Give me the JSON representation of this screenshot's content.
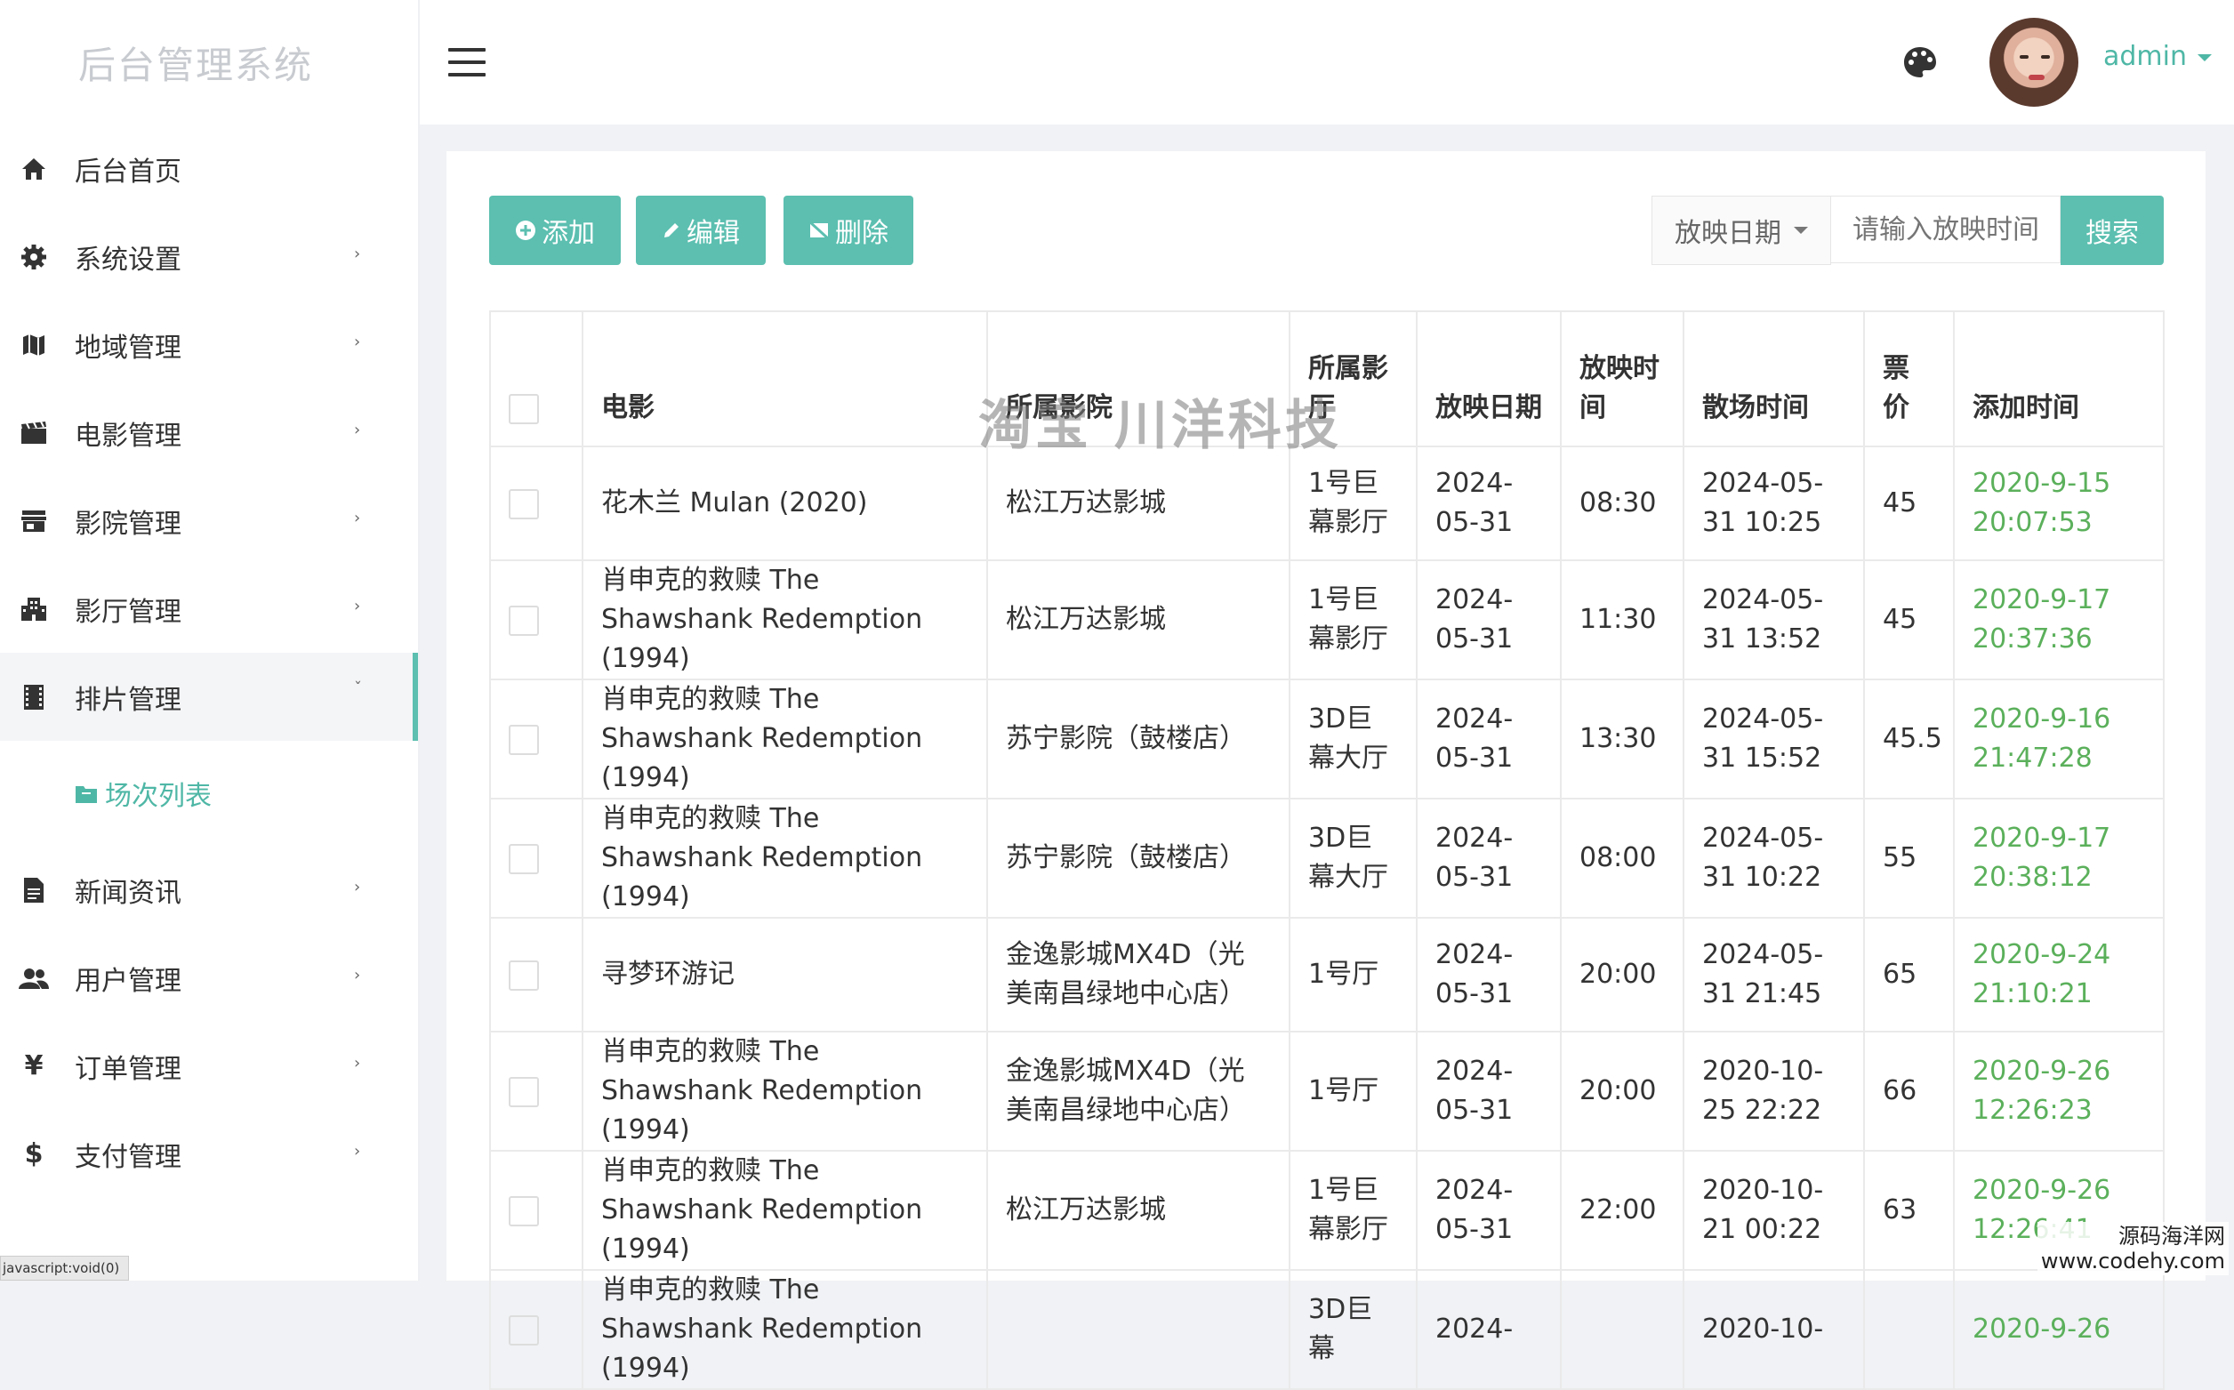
{
  "brand": "后台管理系统",
  "sidebar": {
    "items": [
      {
        "label": "后台首页",
        "icon": "home-icon",
        "has_arrow": false
      },
      {
        "label": "系统设置",
        "icon": "gear-icon",
        "has_arrow": true
      },
      {
        "label": "地域管理",
        "icon": "map-icon",
        "has_arrow": true
      },
      {
        "label": "电影管理",
        "icon": "film-icon",
        "has_arrow": true
      },
      {
        "label": "影院管理",
        "icon": "store-icon",
        "has_arrow": true
      },
      {
        "label": "影厅管理",
        "icon": "building-icon",
        "has_arrow": true
      },
      {
        "label": "排片管理",
        "icon": "schedule-icon",
        "has_arrow": true,
        "expanded": true
      },
      {
        "label": "新闻资讯",
        "icon": "news-icon",
        "has_arrow": true
      },
      {
        "label": "用户管理",
        "icon": "users-icon",
        "has_arrow": true
      },
      {
        "label": "订单管理",
        "icon": "yen-icon",
        "has_arrow": true
      },
      {
        "label": "支付管理",
        "icon": "dollar-icon",
        "has_arrow": true
      }
    ],
    "subitem": "场次列表",
    "status_tip": "javascript:void(0)"
  },
  "header": {
    "username": "admin"
  },
  "toolbar": {
    "add_label": "添加",
    "edit_label": "编辑",
    "delete_label": "删除",
    "filter_select": "放映日期",
    "search_placeholder": "请输入放映时间",
    "search_label": "搜索"
  },
  "table": {
    "headers": [
      "电影",
      "所属影院",
      "所属影厅",
      "放映日期",
      "放映时间",
      "散场时间",
      "票价",
      "添加时间"
    ],
    "rows": [
      {
        "movie": "花木兰 Mulan (2020)",
        "cinema": "松江万达影城",
        "hall": "1号巨幕影厅",
        "date": "2024-05-31",
        "time": "08:30",
        "end": "2024-05-31 10:25",
        "price": "45",
        "added": "2020-9-15 20:07:53"
      },
      {
        "movie": "肖申克的救赎 The Shawshank Redemption (1994)",
        "cinema": "松江万达影城",
        "hall": "1号巨幕影厅",
        "date": "2024-05-31",
        "time": "11:30",
        "end": "2024-05-31 13:52",
        "price": "45",
        "added": "2020-9-17 20:37:36"
      },
      {
        "movie": "肖申克的救赎 The Shawshank Redemption (1994)",
        "cinema": "苏宁影院（鼓楼店）",
        "hall": "3D巨幕大厅",
        "date": "2024-05-31",
        "time": "13:30",
        "end": "2024-05-31 15:52",
        "price": "45.5",
        "added": "2020-9-16 21:47:28"
      },
      {
        "movie": "肖申克的救赎 The Shawshank Redemption (1994)",
        "cinema": "苏宁影院（鼓楼店）",
        "hall": "3D巨幕大厅",
        "date": "2024-05-31",
        "time": "08:00",
        "end": "2024-05-31 10:22",
        "price": "55",
        "added": "2020-9-17 20:38:12"
      },
      {
        "movie": "寻梦环游记",
        "cinema": "金逸影城MX4D（光美南昌绿地中心店）",
        "hall": "1号厅",
        "date": "2024-05-31",
        "time": "20:00",
        "end": "2024-05-31 21:45",
        "price": "65",
        "added": "2020-9-24 21:10:21"
      },
      {
        "movie": "肖申克的救赎 The Shawshank Redemption (1994)",
        "cinema": "金逸影城MX4D（光美南昌绿地中心店）",
        "hall": "1号厅",
        "date": "2024-05-31",
        "time": "20:00",
        "end": "2020-10-25 22:22",
        "price": "66",
        "added": "2020-9-26 12:26:23"
      },
      {
        "movie": "肖申克的救赎 The Shawshank Redemption (1994)",
        "cinema": "松江万达影城",
        "hall": "1号巨幕影厅",
        "date": "2024-05-31",
        "time": "22:00",
        "end": "2020-10-21 00:22",
        "price": "63",
        "added": "2020-9-26 12:26:41"
      },
      {
        "movie": "肖申克的救赎 The Shawshank Redemption (1994)",
        "cinema": "",
        "hall": "3D巨幕",
        "date": "2024-",
        "time": "",
        "end": "2020-10-",
        "price": "",
        "added": "2020-9-26"
      }
    ]
  },
  "overlays": {
    "watermark": "淘宝 川洋科技",
    "corner_line1": "源码海洋网",
    "corner_line2": "www.codehy.com"
  },
  "colors": {
    "accent": "#5cbfb0",
    "added_time": "#5bb05b"
  }
}
